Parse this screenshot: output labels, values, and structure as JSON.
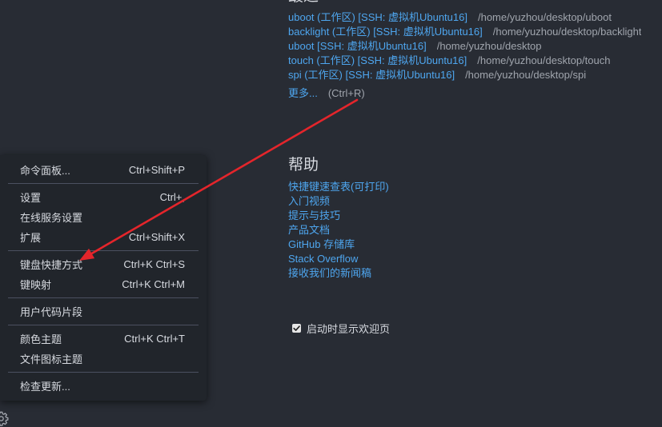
{
  "recent": {
    "heading": "最近",
    "items": [
      {
        "name": "uboot (工作区) [SSH: 虚拟机Ubuntu16]",
        "path": "/home/yuzhou/desktop/uboot"
      },
      {
        "name": "backlight (工作区) [SSH: 虚拟机Ubuntu16]",
        "path": "/home/yuzhou/desktop/backlight"
      },
      {
        "name": "uboot [SSH: 虚拟机Ubuntu16]",
        "path": "/home/yuzhou/desktop"
      },
      {
        "name": "touch (工作区) [SSH: 虚拟机Ubuntu16]",
        "path": "/home/yuzhou/desktop/touch"
      },
      {
        "name": "spi (工作区) [SSH: 虚拟机Ubuntu16]",
        "path": "/home/yuzhou/desktop/spi"
      }
    ],
    "more_label": "更多...",
    "more_shortcut": "(Ctrl+R)"
  },
  "help": {
    "heading": "帮助",
    "links": [
      "快捷键速查表(可打印)",
      "入门视频",
      "提示与技巧",
      "产品文档",
      "GitHub 存储库",
      "Stack Overflow",
      "接收我们的新闻稿"
    ]
  },
  "startup": {
    "label": "启动时显示欢迎页",
    "checked": true
  },
  "menu": {
    "items": [
      {
        "label": "命令面板...",
        "shortcut": "Ctrl+Shift+P"
      },
      {
        "label": "设置",
        "shortcut": "Ctrl+,"
      },
      {
        "label": "在线服务设置"
      },
      {
        "label": "扩展",
        "shortcut": "Ctrl+Shift+X"
      },
      {
        "label": "键盘快捷方式",
        "shortcut": "Ctrl+K Ctrl+S"
      },
      {
        "label": "键映射",
        "shortcut": "Ctrl+K Ctrl+M"
      },
      {
        "label": "用户代码片段"
      },
      {
        "label": "颜色主题",
        "shortcut": "Ctrl+K Ctrl+T"
      },
      {
        "label": "文件图标主题"
      },
      {
        "label": "检查更新..."
      }
    ]
  },
  "icons": {
    "manage": "gear-icon",
    "checkbox": "check-icon"
  },
  "colors": {
    "background": "#282c34",
    "menu_background": "#21252b",
    "link": "#4ea6ef",
    "path_text": "#a0a5ad",
    "annotation_arrow": "#e4252b"
  }
}
